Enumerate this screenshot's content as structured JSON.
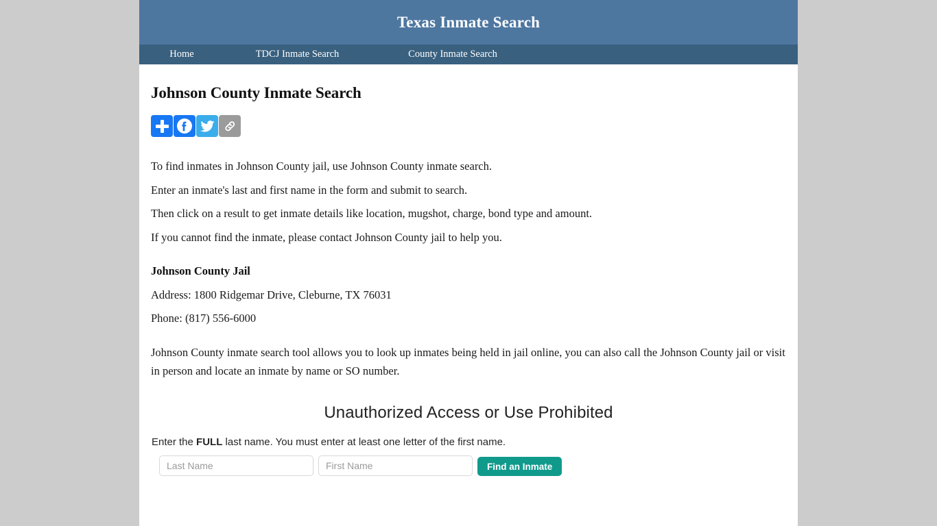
{
  "header": {
    "title": "Texas Inmate Search",
    "bg_color": "#4e77a0"
  },
  "nav": {
    "bg_color": "#39607f",
    "items": [
      {
        "label": "Home",
        "name": "nav-item-home"
      },
      {
        "label": "TDCJ Inmate Search",
        "name": "nav-item-tdcj-inmate-search"
      },
      {
        "label": "County Inmate Search",
        "name": "nav-item-county-inmate-search"
      }
    ]
  },
  "main": {
    "heading": "Johnson County Inmate Search",
    "share": [
      {
        "label": "Share",
        "icon": "plus-icon",
        "color": "#1878f3"
      },
      {
        "label": "Facebook",
        "icon": "facebook-icon",
        "color": "#1877f2"
      },
      {
        "label": "Twitter",
        "icon": "twitter-icon",
        "color": "#3badeb"
      },
      {
        "label": "Copy Link",
        "icon": "link-icon",
        "color": "#9b9b9b"
      }
    ],
    "intro_lines": [
      "To find inmates in Johnson County jail, use Johnson County inmate search.",
      "Enter an inmate's last and first name in the form and submit to search.",
      "Then click on a result to get inmate details like location, mugshot, charge, bond type and amount.",
      "If you cannot find the inmate, please contact Johnson County jail to help you."
    ],
    "jail": {
      "name": "Johnson County Jail",
      "address": "Address: 1800 Ridgemar Drive, Cleburne, TX 76031",
      "phone": "Phone: (817) 556-6000"
    },
    "tool_paragraph": "Johnson County inmate search tool allows you to look up inmates being held in jail online, you can also call the Johnson County jail or visit in person and locate an inmate by name or SO number."
  },
  "search_widget": {
    "title": "Unauthorized Access or Use Prohibited",
    "instruction_prefix": "Enter the ",
    "instruction_bold": "FULL",
    "instruction_suffix": " last name. You must enter at least one letter of the first name.",
    "last_name_value": "",
    "last_name_placeholder": "Last Name",
    "first_name_value": "",
    "first_name_placeholder": "First Name",
    "submit_label": "Find an Inmate",
    "submit_color": "#109a8c"
  }
}
